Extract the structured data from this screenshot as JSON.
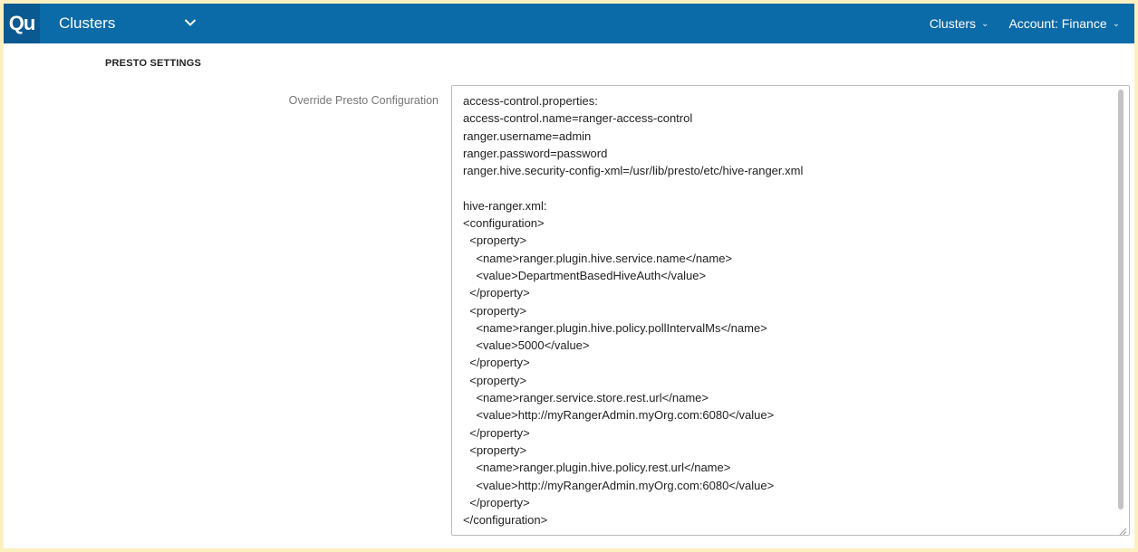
{
  "header": {
    "logo_text": "Qu",
    "app_title": "Clusters",
    "nav": [
      {
        "label": "Clusters",
        "caret": "⌄"
      },
      {
        "label": "Account: Finance",
        "caret": "⌄"
      }
    ]
  },
  "section": {
    "heading": "PRESTO SETTINGS"
  },
  "field": {
    "label": "Override Presto Configuration",
    "lines": [
      "access-control.properties:",
      "access-control.name=ranger-access-control",
      "ranger.username=admin",
      "ranger.password=password",
      "ranger.hive.security-config-xml=/usr/lib/presto/etc/hive-ranger.xml",
      "",
      "hive-ranger.xml:",
      "<configuration>",
      "  <property>",
      "    <name>ranger.plugin.hive.service.name</name>",
      "    <value>DepartmentBasedHiveAuth</value>",
      "  </property>",
      "  <property>",
      "    <name>ranger.plugin.hive.policy.pollIntervalMs</name>",
      "    <value>5000</value>",
      "  </property>",
      "  <property>",
      "    <name>ranger.service.store.rest.url</name>",
      "    <value>http://myRangerAdmin.myOrg.com:6080</value>",
      "  </property>",
      "  <property>",
      "    <name>ranger.plugin.hive.policy.rest.url</name>",
      "    <value>http://myRangerAdmin.myOrg.com:6080</value>",
      "  </property>",
      "</configuration>"
    ]
  },
  "colors": {
    "header_bg": "#0b6aa8",
    "page_border": "#fdf0c0"
  }
}
